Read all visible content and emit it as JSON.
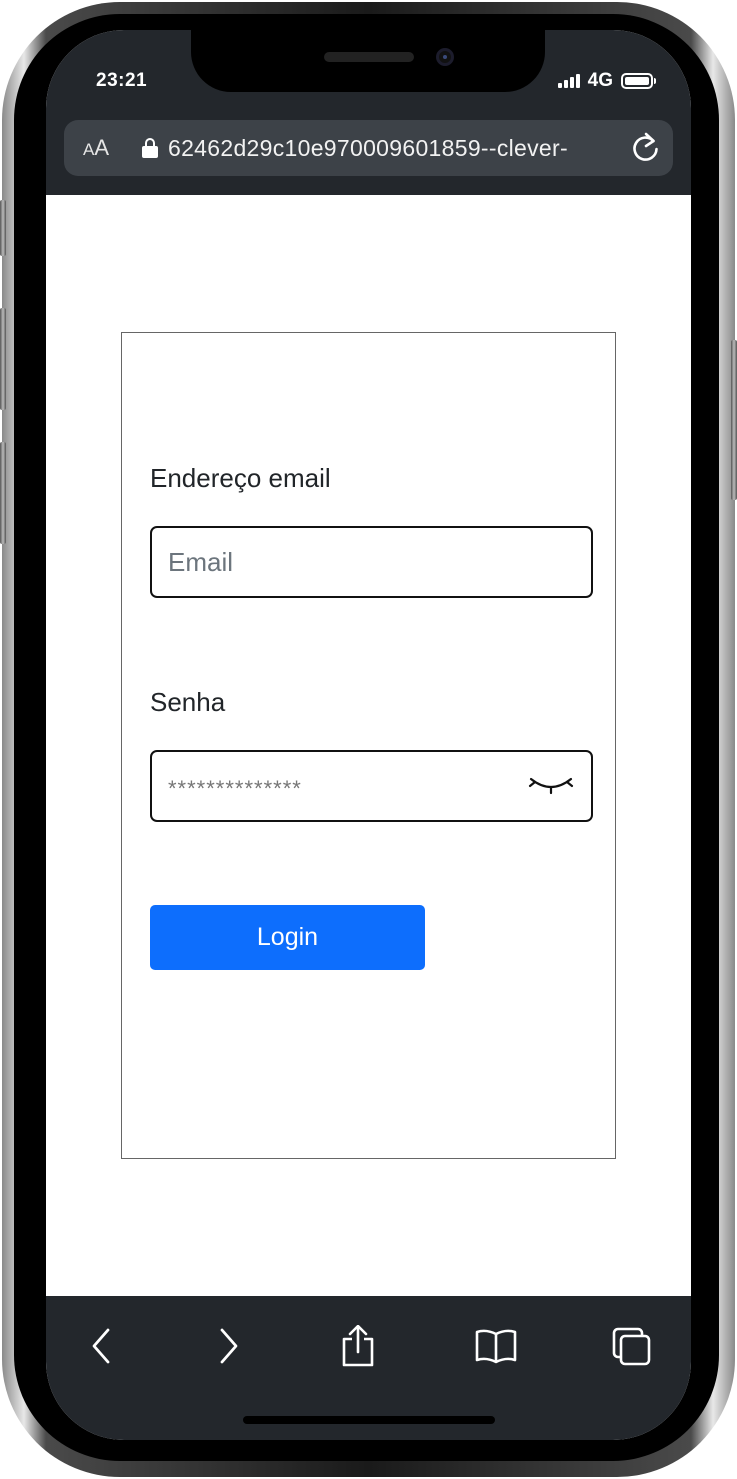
{
  "status_bar": {
    "time": "23:21",
    "network": "4G"
  },
  "browser": {
    "text_size_label_small": "A",
    "text_size_label_large": "A",
    "url": "62462d29c10e970009601859--clever-"
  },
  "login_form": {
    "email_label": "Endereço email",
    "email_placeholder": "Email",
    "password_label": "Senha",
    "password_value": "**************",
    "login_button_label": "Login"
  },
  "toolbar": {
    "icons": [
      "back-icon",
      "forward-icon",
      "share-icon",
      "bookmarks-icon",
      "tabs-icon"
    ]
  },
  "colors": {
    "chrome_background": "#23272c",
    "url_bar_background": "#3d4248",
    "primary_button": "#0d6efd",
    "page_background": "#ffffff"
  }
}
